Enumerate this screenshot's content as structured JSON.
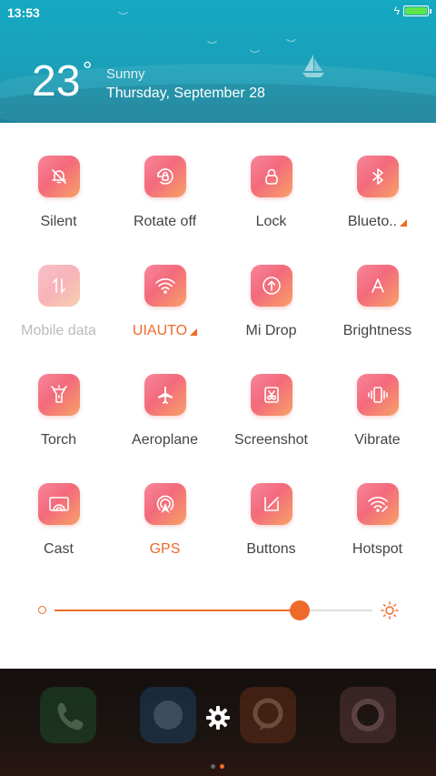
{
  "status_bar": {
    "time": "13:53",
    "battery_color": "#5ee54d",
    "icons": [
      "charging-icon",
      "battery-icon"
    ]
  },
  "weather": {
    "temperature": "23",
    "degree_symbol": "°",
    "condition": "Sunny",
    "date": "Thursday, September 28"
  },
  "tiles": [
    {
      "label": "Silent",
      "icon": "bell-off-icon"
    },
    {
      "label": "Rotate off",
      "icon": "rotate-lock-icon"
    },
    {
      "label": "Lock",
      "icon": "lock-icon"
    },
    {
      "label": "Blueto..",
      "icon": "bluetooth-icon"
    },
    {
      "label": "Mobile data",
      "icon": "mobile-data-icon"
    },
    {
      "label": "UIAUTO",
      "icon": "wifi-icon"
    },
    {
      "label": "Mi Drop",
      "icon": "upload-icon"
    },
    {
      "label": "Brightness",
      "icon": "letter-a-icon"
    },
    {
      "label": "Torch",
      "icon": "torch-icon"
    },
    {
      "label": "Aeroplane",
      "icon": "aeroplane-icon"
    },
    {
      "label": "Screenshot",
      "icon": "screenshot-icon"
    },
    {
      "label": "Vibrate",
      "icon": "vibrate-icon"
    },
    {
      "label": "Cast",
      "icon": "cast-icon"
    },
    {
      "label": "GPS",
      "icon": "gps-icon"
    },
    {
      "label": "Buttons",
      "icon": "buttons-icon"
    },
    {
      "label": "Hotspot",
      "icon": "hotspot-icon"
    }
  ],
  "brightness": {
    "level": 0.77,
    "accent": "#ee6a2a",
    "min_icon": "brightness-low-icon",
    "max_icon": "brightness-high-icon"
  },
  "dock": {
    "apps": [
      "phone-icon",
      "messages-icon",
      "chat-icon",
      "camera-icon"
    ],
    "settings_icon": "gear-icon",
    "pages": 2,
    "active_page": 1
  }
}
